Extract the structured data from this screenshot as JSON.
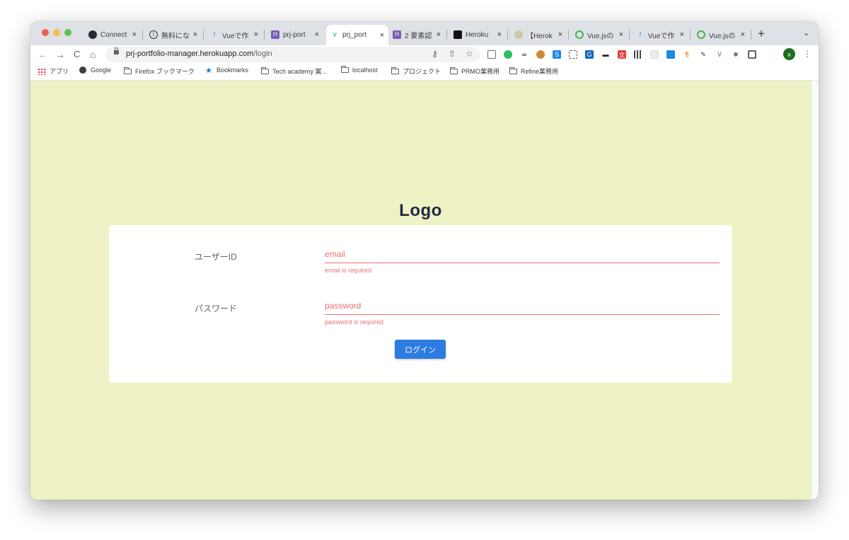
{
  "browser": {
    "tabs": [
      {
        "title": "Connect",
        "favicon": "github-icon",
        "fav_color": "#24292e"
      },
      {
        "title": "無料にな",
        "favicon": "info-icon",
        "fav_color": "#333333"
      },
      {
        "title": "Vueで作",
        "favicon": "slash-icon",
        "fav_color": "#3b8de6"
      },
      {
        "title": "prj-port",
        "favicon": "heroku-icon",
        "fav_color": "#7a5db8"
      },
      {
        "title": "prj_port",
        "favicon": "vue-icon",
        "fav_color": "#41b883",
        "active": true
      },
      {
        "title": "2 要素認",
        "favicon": "heroku-icon",
        "fav_color": "#7a5db8"
      },
      {
        "title": "Heroku",
        "favicon": "square-icon",
        "fav_color": "#111111"
      },
      {
        "title": "【Herok",
        "favicon": "person-icon",
        "fav_color": "#9a9a7a"
      },
      {
        "title": "Vue.jsの",
        "favicon": "circle-icon",
        "fav_color": "#45b649"
      },
      {
        "title": "Vueで作",
        "favicon": "slash-icon",
        "fav_color": "#3b8de6"
      },
      {
        "title": "Vue.jsの",
        "favicon": "circle-icon",
        "fav_color": "#45b649"
      }
    ],
    "tab_close": "×",
    "new_tab": "+",
    "tab_list": "⌄",
    "nav": {
      "back": "←",
      "forward": "→",
      "reload": "C",
      "home": "⌂"
    },
    "url": {
      "host": "prj-portfolio-manager.herokuapp.com",
      "path": "/login"
    },
    "omnibox_icons": {
      "key": "⚷",
      "share": "⇧",
      "star": "☆"
    },
    "extensions": [
      {
        "name": "screen-icon",
        "color": "#6f6f6f"
      },
      {
        "name": "evernote-icon",
        "color": "#2dbe60"
      },
      {
        "name": "glasses-icon",
        "color": "#333333"
      },
      {
        "name": "paint-icon",
        "color": "#c98b3a"
      },
      {
        "name": "s-icon",
        "color": "#1e88e5"
      },
      {
        "name": "capture-icon",
        "color": "#555555"
      },
      {
        "name": "g-icon",
        "color": "#1565c0"
      },
      {
        "name": "dash-icon",
        "color": "#222222"
      },
      {
        "name": "translate-icon",
        "color": "#e53935"
      },
      {
        "name": "qr-icon",
        "color": "#444444"
      },
      {
        "name": "blank-icon",
        "color": "#e6e6e6"
      },
      {
        "name": "image-icon",
        "color": "#1e88e5"
      },
      {
        "name": "pilcrow-icon",
        "color": "#e57b00"
      },
      {
        "name": "eyedropper-icon",
        "color": "#333333"
      },
      {
        "name": "vue-devtools-icon",
        "color": "#41b883"
      },
      {
        "name": "puzzle-icon",
        "color": "#5f6368"
      },
      {
        "name": "sidepanel-icon",
        "color": "#5f6368"
      }
    ],
    "profile_initial": "x",
    "menu": "⋮"
  },
  "bookmarks": [
    {
      "label": "アプリ",
      "icon": "apps-grid-icon"
    },
    {
      "label": "Google",
      "icon": "globe-icon"
    },
    {
      "label": "Firefox ブックマーク",
      "icon": "folder-icon"
    },
    {
      "label": "Bookmarks",
      "icon": "star-icon"
    },
    {
      "label": "Tech academy 案...",
      "icon": "folder-icon"
    },
    {
      "label": "localhost",
      "icon": "folder-icon"
    },
    {
      "label": "プロジェクト",
      "icon": "folder-icon"
    },
    {
      "label": "PRMO業務用",
      "icon": "folder-icon"
    },
    {
      "label": "Refine業務用",
      "icon": "folder-icon"
    }
  ],
  "page": {
    "logo": "Logo",
    "form": {
      "user_label": "ユーザーID",
      "email_placeholder": "email",
      "email_error": "email is required",
      "password_label": "パスワード",
      "password_placeholder": "password",
      "password_error": "password is required",
      "login_button": "ログイン"
    },
    "colors": {
      "background": "#eef2c4",
      "error": "#e57373",
      "button": "#2d7be0",
      "logo": "#1e2a44"
    }
  }
}
